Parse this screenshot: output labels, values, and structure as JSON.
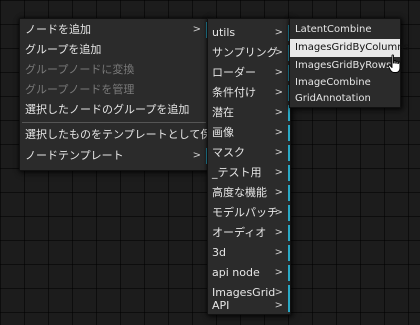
{
  "colors": {
    "menu_background": "#2b2b2b",
    "submenu_indicator": "#2aa9c6",
    "highlight_background": "#e8e8e8",
    "disabled_text": "#7a7a7a"
  },
  "arrow_symbol": ">",
  "main_menu": {
    "items": [
      {
        "label": "ノードを追加"
      },
      {
        "label": "グループを追加"
      },
      {
        "label": "グループノードに変換"
      },
      {
        "label": "グループノードを管理"
      },
      {
        "label": "選択したノードのグループを追加"
      },
      {
        "label": "選択したものをテンプレートとして保存"
      },
      {
        "label": "ノードテンプレート"
      }
    ]
  },
  "category_menu": {
    "items": [
      {
        "label": "utils"
      },
      {
        "label": "サンプリング"
      },
      {
        "label": "ローダー"
      },
      {
        "label": "条件付け"
      },
      {
        "label": "潜在"
      },
      {
        "label": "画像"
      },
      {
        "label": "マスク"
      },
      {
        "label": "_テスト用"
      },
      {
        "label": "高度な機能"
      },
      {
        "label": "モデルパッチ"
      },
      {
        "label": "オーディオ"
      },
      {
        "label": "3d"
      },
      {
        "label": "api node"
      },
      {
        "label": "ImagesGrid"
      },
      {
        "label": "API"
      }
    ]
  },
  "utils_menu": {
    "items": [
      {
        "label": "LatentCombine"
      },
      {
        "label": "ImagesGridByColumns"
      },
      {
        "label": "ImagesGridByRows"
      },
      {
        "label": "ImageCombine"
      },
      {
        "label": "GridAnnotation"
      }
    ]
  }
}
